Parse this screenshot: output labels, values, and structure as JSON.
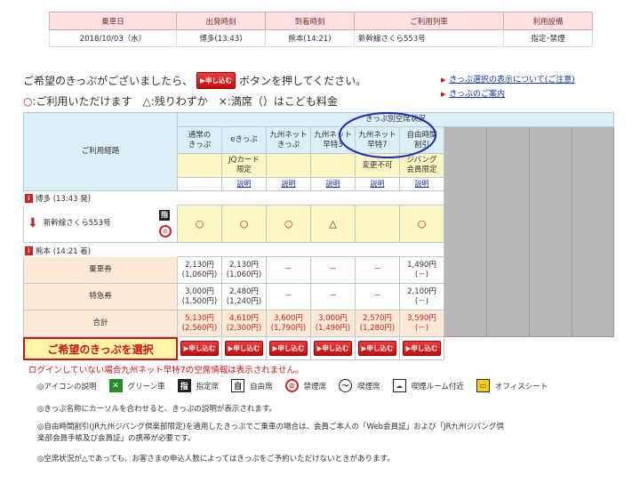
{
  "summary": {
    "headers": [
      "乗車日",
      "出発時刻",
      "到着時刻",
      "ご利用列車",
      "利用設備"
    ],
    "row": [
      "2018/10/03（水）",
      "博多(13:43)",
      "熊本(14:21)",
      "新幹線さくら553号",
      "指定･禁煙"
    ]
  },
  "intro": {
    "before": "ご希望のきっぷがございましたら、",
    "button": "▶申し込む",
    "after": "ボタンを押してください。"
  },
  "legend": {
    "circle": "○",
    "text": ":ご利用いただけます　△:残りわずか　×:満席（）はこども料金"
  },
  "side_links": [
    "きっぷ選択の表示について(ご注意)",
    "きっぷのご案内"
  ],
  "grid": {
    "route_header": "ご利用経路",
    "status_header": "きっぷ別空席状況",
    "columns": [
      {
        "name": "通常の\nきっぷ",
        "note": "",
        "link": "",
        "avail": "○",
        "fare": "2,130円\n(1,060円)",
        "express": "3,000円\n(1,500円)",
        "total": "5,130円\n(2,560円)"
      },
      {
        "name": "eきっぷ",
        "note": "JQカード\n限定",
        "link": "説明",
        "avail": "○",
        "fare": "2,130円\n(1,060円)",
        "express": "2,480円\n(1,240円)",
        "total": "4,610円\n(2,300円)"
      },
      {
        "name": "九州ネット\nきっぷ",
        "note": "",
        "link": "説明",
        "avail": "○",
        "fare": "－",
        "express": "－",
        "total": "3,600円\n(1,790円)"
      },
      {
        "name": "九州ネット\n早特3",
        "note": "",
        "link": "説明",
        "avail": "△",
        "fare": "－",
        "express": "－",
        "total": "3,000円\n(1,490円)"
      },
      {
        "name": "九州ネット\n早特7",
        "note": "変更不可",
        "link": "説明",
        "avail": "",
        "fare": "－",
        "express": "－",
        "total": "2,570円\n(1,280円)"
      },
      {
        "name": "自由時間\n割引",
        "note": "ジパング\n会員限定",
        "link": "説明",
        "avail": "○",
        "fare": "1,490円\n(－)",
        "express": "2,100円\n(－)",
        "total": "3,590円\n(－)"
      }
    ],
    "departure": "博多 (13:43 発)",
    "train": "新幹線さくら553号",
    "arrival": "熊本 (14:21 着)",
    "seat_icon": "指",
    "row_labels": {
      "fare": "乗車券",
      "express": "特急券",
      "total": "合計"
    },
    "apply_label": "▶申し込む",
    "select_label": "ご希望のきっぷを選択"
  },
  "warning": "ログインしていない場合九州ネット早特7の空席情報は表示されません。",
  "icon_legend": {
    "title": "◎アイコンの説明",
    "items": [
      {
        "icon": "green-car-icon",
        "label": "グリーン車"
      },
      {
        "icon": "reserved-seat-icon",
        "glyph": "指",
        "label": "指定席"
      },
      {
        "icon": "non-reserved-seat-icon",
        "glyph": "自",
        "label": "自由席"
      },
      {
        "icon": "no-smoking-icon",
        "label": "禁煙席"
      },
      {
        "icon": "smoking-icon",
        "label": "喫煙席"
      },
      {
        "icon": "smoking-room-icon",
        "label": "喫煙ルーム付近"
      },
      {
        "icon": "office-seat-icon",
        "label": "オフィスシート"
      }
    ]
  },
  "notes": [
    "◎きっぷ名称にカーソルを合わせると、きっぷの説明が表示されます。",
    "◎自由時間割引(JR九州ジパング倶楽部限定)を適用したきっぷでご乗車の場合は、会員ご本人の「Web会員証」および「JR九州ジパング倶",
    "楽部会員手帳及び会員証」の携帯が必要です。",
    "◎空席状況が△であっても、お客さまの申込人数によってはきっぷをご予約いただけないときがあります。"
  ]
}
